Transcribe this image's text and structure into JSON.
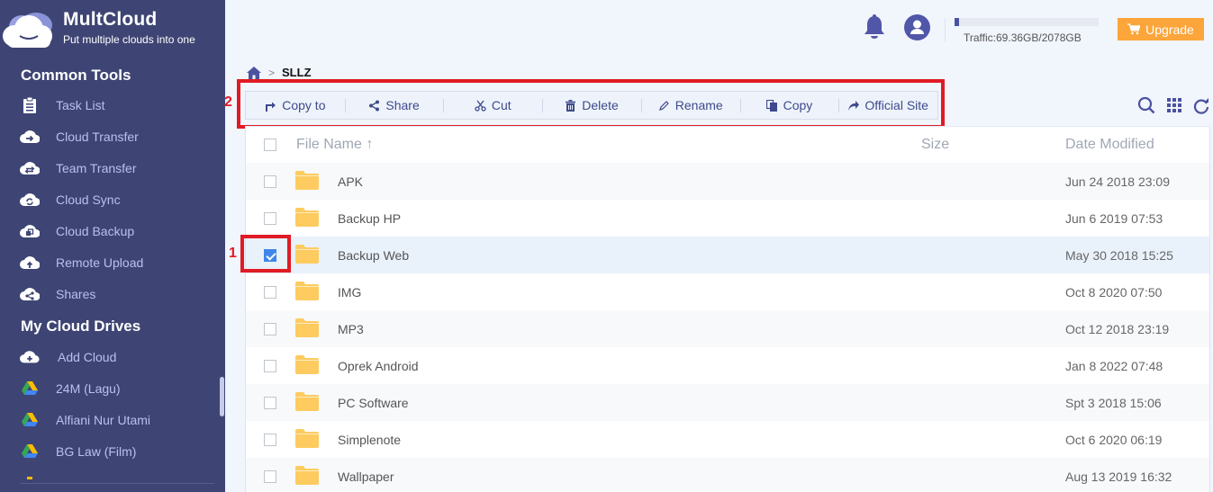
{
  "app": {
    "name": "MultCloud",
    "tagline": "Put multiple clouds into one"
  },
  "sidebar": {
    "common_tools_title": "Common Tools",
    "common_tools": [
      {
        "label": "Task List",
        "icon": "clipboard-icon"
      },
      {
        "label": "Cloud Transfer",
        "icon": "cloud-transfer-icon"
      },
      {
        "label": "Team Transfer",
        "icon": "team-transfer-icon"
      },
      {
        "label": "Cloud Sync",
        "icon": "cloud-sync-icon"
      },
      {
        "label": "Cloud Backup",
        "icon": "cloud-backup-icon"
      },
      {
        "label": "Remote Upload",
        "icon": "cloud-upload-icon"
      },
      {
        "label": "Shares",
        "icon": "share-cloud-icon"
      }
    ],
    "drives_title": "My Cloud Drives",
    "drives": [
      {
        "label": "Add Cloud",
        "icon": "add-cloud-icon"
      },
      {
        "label": "24M (Lagu)",
        "icon": "google-drive-icon"
      },
      {
        "label": "Alfiani Nur Utami",
        "icon": "google-drive-icon"
      },
      {
        "label": "BG Law (Film)",
        "icon": "google-drive-icon"
      }
    ]
  },
  "header": {
    "traffic_text": "Traffic:69.36GB/2078GB",
    "traffic_used_fraction": 0.0334,
    "upgrade_label": "Upgrade"
  },
  "breadcrumb": {
    "current": "SLLZ"
  },
  "toolbar": {
    "buttons": [
      {
        "label": "Copy to",
        "icon": "copy-to-icon"
      },
      {
        "label": "Share",
        "icon": "share-icon"
      },
      {
        "label": "Cut",
        "icon": "cut-icon"
      },
      {
        "label": "Delete",
        "icon": "trash-icon"
      },
      {
        "label": "Rename",
        "icon": "pencil-icon"
      },
      {
        "label": "Copy",
        "icon": "copy-icon"
      },
      {
        "label": "Official Site",
        "icon": "external-link-icon"
      }
    ]
  },
  "annotations": {
    "row_marker": "1",
    "toolbar_marker": "2"
  },
  "table": {
    "columns": {
      "name": "File Name",
      "size": "Size",
      "date": "Date Modified"
    },
    "sort_indicator": "↑",
    "rows": [
      {
        "name": "APK",
        "size": "",
        "date": "Jun 24 2018 23:09",
        "checked": false
      },
      {
        "name": "Backup HP",
        "size": "",
        "date": "Jun 6 2019 07:53",
        "checked": false
      },
      {
        "name": "Backup Web",
        "size": "",
        "date": "May 30 2018 15:25",
        "checked": true
      },
      {
        "name": "IMG",
        "size": "",
        "date": "Oct 8 2020 07:50",
        "checked": false
      },
      {
        "name": "MP3",
        "size": "",
        "date": "Oct 12 2018 23:19",
        "checked": false
      },
      {
        "name": "Oprek Android",
        "size": "",
        "date": "Jan 8 2022 07:48",
        "checked": false
      },
      {
        "name": "PC Software",
        "size": "",
        "date": "Spt 3 2018 15:06",
        "checked": false
      },
      {
        "name": "Simplenote",
        "size": "",
        "date": "Oct 6 2020 06:19",
        "checked": false
      },
      {
        "name": "Wallpaper",
        "size": "",
        "date": "Aug 13 2019 16:32",
        "checked": false
      }
    ]
  },
  "colors": {
    "sidebar_bg": "#3e4574",
    "accent": "#4b52a0",
    "upgrade": "#fba53a",
    "folder": "#fdcb5f",
    "checkbox_checked": "#3f86ea",
    "annotation_red": "#e01b24"
  }
}
